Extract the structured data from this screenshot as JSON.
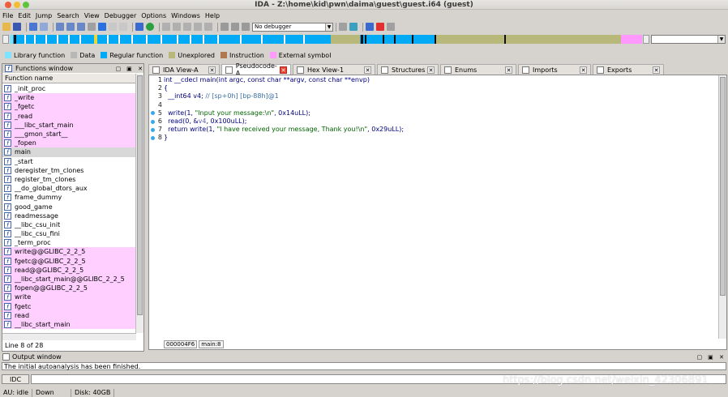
{
  "window": {
    "title": "IDA - Z:\\home\\kid\\pwn\\daima\\guest\\guest.i64 (guest)"
  },
  "menu": [
    "File",
    "Edit",
    "Jump",
    "Search",
    "View",
    "Debugger",
    "Options",
    "Windows",
    "Help"
  ],
  "toolbar": {
    "debugger_select": "No debugger"
  },
  "legend": [
    {
      "label": "Library function",
      "color": "#7fe3ff"
    },
    {
      "label": "Data",
      "color": "#b8b8b8"
    },
    {
      "label": "Regular function",
      "color": "#00aaf5"
    },
    {
      "label": "Unexplored",
      "color": "#b8b87a"
    },
    {
      "label": "Instruction",
      "color": "#b07850"
    },
    {
      "label": "External symbol",
      "color": "#ff99ff"
    }
  ],
  "functions": {
    "title": "Functions window",
    "column": "Function name",
    "items": [
      {
        "name": "_init_proc",
        "lib": false
      },
      {
        "name": "_write",
        "lib": true
      },
      {
        "name": "_fgetc",
        "lib": true
      },
      {
        "name": "_read",
        "lib": true
      },
      {
        "name": "___libc_start_main",
        "lib": true
      },
      {
        "name": "___gmon_start__",
        "lib": true
      },
      {
        "name": "_fopen",
        "lib": true
      },
      {
        "name": "main",
        "lib": false,
        "sel": true
      },
      {
        "name": "_start",
        "lib": false
      },
      {
        "name": "deregister_tm_clones",
        "lib": false
      },
      {
        "name": "register_tm_clones",
        "lib": false
      },
      {
        "name": "__do_global_dtors_aux",
        "lib": false
      },
      {
        "name": "frame_dummy",
        "lib": false
      },
      {
        "name": "good_game",
        "lib": false
      },
      {
        "name": "readmessage",
        "lib": false
      },
      {
        "name": "__libc_csu_init",
        "lib": false
      },
      {
        "name": "__libc_csu_fini",
        "lib": false
      },
      {
        "name": "_term_proc",
        "lib": false
      },
      {
        "name": "write@@GLIBC_2_2_5",
        "lib": true
      },
      {
        "name": "fgetc@@GLIBC_2_2_5",
        "lib": true
      },
      {
        "name": "read@@GLIBC_2_2_5",
        "lib": true
      },
      {
        "name": "__libc_start_main@@GLIBC_2_2_5",
        "lib": true
      },
      {
        "name": "fopen@@GLIBC_2_2_5",
        "lib": true
      },
      {
        "name": "write",
        "lib": true
      },
      {
        "name": "fgetc",
        "lib": true
      },
      {
        "name": "read",
        "lib": true
      },
      {
        "name": "__libc_start_main",
        "lib": true
      }
    ],
    "status": "Line 8 of 28"
  },
  "tabs": [
    {
      "label": "IDA View-A",
      "active": false
    },
    {
      "label": "Pseudocode-A",
      "active": true
    },
    {
      "label": "Hex View-1",
      "active": false
    },
    {
      "label": "Structures",
      "active": false
    },
    {
      "label": "Enums",
      "active": false
    },
    {
      "label": "Imports",
      "active": false
    },
    {
      "label": "Exports",
      "active": false
    }
  ],
  "code": {
    "lines": [
      {
        "n": "1",
        "dot": false,
        "text": "int __cdecl main(int argc, const char **argv, const char **envp)"
      },
      {
        "n": "2",
        "dot": false,
        "text": "{"
      },
      {
        "n": "3",
        "dot": false,
        "pre": "  __int64 v4; ",
        "comment": "// [sp+0h] [bp-88h]@1"
      },
      {
        "n": "4",
        "dot": false,
        "text": ""
      },
      {
        "n": "5",
        "dot": true,
        "pre": "  write(1, ",
        "str": "\"Input your message:\\n\"",
        "post": ", 0x14uLL);"
      },
      {
        "n": "6",
        "dot": true,
        "pre": "  read(0, &",
        "var": "v4",
        "post": ", 0x100uLL);"
      },
      {
        "n": "7",
        "dot": true,
        "pre": "  return write(1, ",
        "str": "\"I have received your message, Thank you!\\n\"",
        "post": ", 0x29uLL);"
      },
      {
        "n": "8",
        "dot": true,
        "text": "}"
      }
    ],
    "status_addr": "000004F6",
    "status_func": "main:8"
  },
  "output": {
    "title": "Output window",
    "message": "The initial autoanalysis has been finished.",
    "idc_label": "IDC"
  },
  "statusbar": {
    "au": "AU:",
    "state": "idle",
    "direction": "Down",
    "disk": "Disk: 40GB"
  },
  "watermark": "https://blog.csdn.net/weixin_42306891"
}
